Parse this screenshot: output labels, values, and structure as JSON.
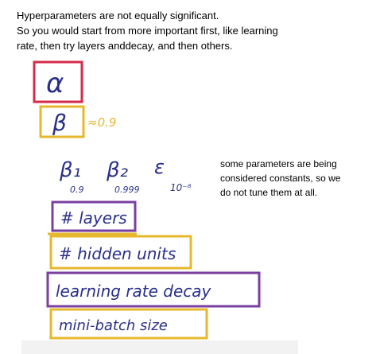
{
  "intro": {
    "line1": "Hyperparameters are not equally significant.",
    "line2": "So you would start from more important first, like learning",
    "line3": "rate, then try layers anddecay, and then others."
  },
  "side_note": {
    "line1": "some parameters are being",
    "line2": "considered constants, so we",
    "line3": "do not tune them at all."
  },
  "handwriting": {
    "alpha": "α",
    "beta": "β",
    "beta_note": "≈0.9",
    "beta1": "β₁",
    "beta1_value": "0.9",
    "beta2": "β₂",
    "beta2_value": "0.999",
    "epsilon": "ε",
    "epsilon_value": "10⁻⁸",
    "layers": "# layers",
    "hidden_units": "# hidden units",
    "lr_decay": "learning rate decay",
    "mini_batch": "mini-batch size"
  },
  "colors": {
    "priority_1": "#d62b4b",
    "priority_2": "#e6b82e",
    "priority_3": "#7a3fa0",
    "ink": "#2a2f8a"
  }
}
